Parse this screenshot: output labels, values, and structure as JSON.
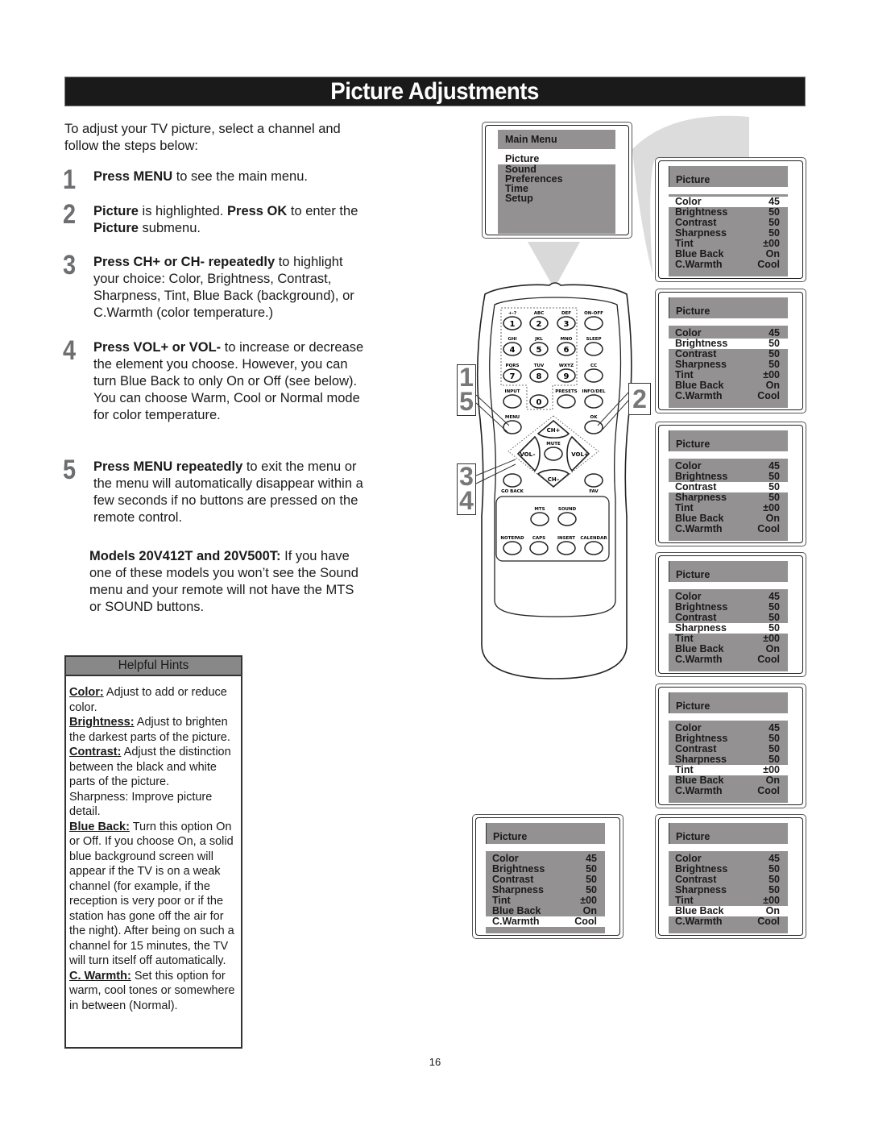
{
  "page": {
    "title": "Picture Adjustments",
    "page_number": "16"
  },
  "intro": "To adjust your TV picture, select a channel and follow the steps below:",
  "steps": [
    {
      "number": "1",
      "bold1": "Press MENU",
      "rest1": " to see the main menu."
    },
    {
      "number": "2",
      "bold1": "Picture",
      "rest1": " is highlighted. ",
      "bold2": "Press OK",
      "rest2": " to enter the ",
      "bold3": "Picture",
      "rest3": " submenu."
    },
    {
      "number": "3",
      "bold1": "Press CH+ or CH- repeatedly",
      "rest1": " to highlight your choice: Color, Brightness, Contrast, Sharpness, Tint, Blue Back (background), or C.Warmth (color temperature.)"
    },
    {
      "number": "4",
      "bold1": "Press VOL+ or VOL-",
      "rest1": " to increase or decrease the element you choose. However, you can turn Blue Back to only On or Off (see below). You can choose Warm, Cool or Normal mode for color temperature."
    },
    {
      "number": "5",
      "bold1": "Press MENU repeatedly",
      "rest1": " to exit the menu or the menu will automatically disappear within a few seconds if no buttons are pressed on the remote control."
    }
  ],
  "models_note": {
    "bold": "Models 20V412T and 20V500T:",
    "rest": " If you have one of these models you won’t see the Sound menu and your remote will not have the MTS or SOUND buttons."
  },
  "hints": {
    "heading": "Helpful Hints",
    "items": [
      {
        "term": "Color:",
        "text": " Adjust to add or reduce color."
      },
      {
        "term": "Brightness:",
        "text": " Adjust to brighten the darkest parts of the picture."
      },
      {
        "term": "Contrast:",
        "text": " Adjust the distinction between the black and white parts of the picture."
      },
      {
        "term": "",
        "text": "Sharpness: Improve picture detail."
      },
      {
        "term": "Blue Back:",
        "text": " Turn this option On or Off. If you choose On, a solid blue background screen will appear if the TV is on a weak channel (for example, if the reception is very poor or if the station has gone off the air for the night). After being on such a channel for 15 minutes, the TV will turn itself off automatically."
      },
      {
        "term": "C. Warmth:",
        "text": " Set this option for warm, cool tones or somewhere in between (Normal)."
      }
    ]
  },
  "main_menu": {
    "title": "Main Menu",
    "items": [
      "Picture",
      "Sound",
      "Preferences",
      "Time",
      "Setup"
    ],
    "selected": 0
  },
  "picture_menu": {
    "title": "Picture",
    "rows": [
      {
        "label": "Color",
        "value": "45"
      },
      {
        "label": "Brightness",
        "value": "50"
      },
      {
        "label": "Contrast",
        "value": "50"
      },
      {
        "label": "Sharpness",
        "value": "50"
      },
      {
        "label": "Tint",
        "value": "±00"
      },
      {
        "label": "Blue Back",
        "value": "On"
      },
      {
        "label": "C.Warmth",
        "value": "Cool"
      }
    ],
    "panels_selected_row": [
      0,
      1,
      2,
      3,
      4,
      6,
      5
    ]
  },
  "callouts": [
    "1",
    "5",
    "2",
    "3",
    "4"
  ],
  "remote": {
    "number_keys": [
      {
        "sub": "+-?",
        "key": "1"
      },
      {
        "sub": "ABC",
        "key": "2"
      },
      {
        "sub": "DEF",
        "key": "3"
      },
      {
        "sub": "GHI",
        "key": "4"
      },
      {
        "sub": "JKL",
        "key": "5"
      },
      {
        "sub": "MNO",
        "key": "6"
      },
      {
        "sub": "PQRS",
        "key": "7"
      },
      {
        "sub": "TUV",
        "key": "8"
      },
      {
        "sub": "WXYZ",
        "key": "9"
      },
      {
        "sub": "",
        "key": "0"
      }
    ],
    "side_keys": [
      "ON-OFF",
      "SLEEP",
      "CC",
      "INFO/DEL"
    ],
    "input": "INPUT",
    "presets": "PRESETS",
    "menu": "MENU",
    "ok": "OK",
    "ch_up": "CH+",
    "ch_down": "CH–",
    "vol_down": "VOL–",
    "vol_up": "VOL+",
    "mute": "MUTE",
    "go_back": "GO BACK",
    "fav": "FAV",
    "mts": "MTS",
    "sound": "SOUND",
    "bottom_row": [
      "NOTEPAD",
      "CAPS",
      "INSERT",
      "CALENDAR"
    ]
  }
}
